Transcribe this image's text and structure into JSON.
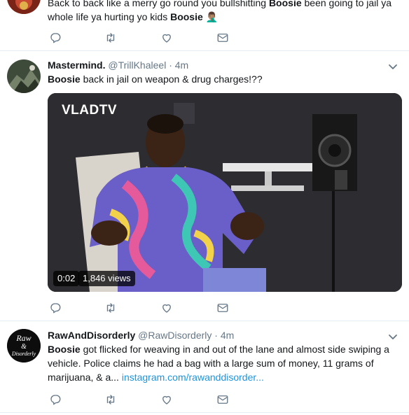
{
  "tweet1": {
    "text_a": "Back to back like a merry go round you bullshitting ",
    "boosie": "Boosie",
    "text_b": " been going to jail ya",
    "text_c": "whole life ya hurting yo kids ",
    "emoji": "🤦🏽‍♂️"
  },
  "tweet2": {
    "name": "Mastermind.",
    "handle": "@TrillKhaleel",
    "time": "· 4m",
    "boosie": "Boosie",
    "text": " back in jail on weapon & drug charges!??",
    "video": {
      "watermark": "VLADTV",
      "duration": "0:02",
      "views": "1,846 views"
    }
  },
  "tweet3": {
    "name": "RawAndDisorderly",
    "handle": "@RawDisorderly",
    "time": "· 4m",
    "boosie": "Boosie",
    "line1": " got flicked for weaving in and out of the lane and almost side swiping a",
    "line2": "vehicle. Police claims he had a bag with a large sum of money, 11 grams of",
    "line3": "marijuana, & a... ",
    "link": "instagram.com/rawanddisorder...",
    "avatar_text": "Raw & Disorderly"
  },
  "icons": [
    "reply-icon",
    "retweet-icon",
    "like-icon",
    "dm-icon",
    "caret-down-icon"
  ],
  "colors": {
    "icon": "#657786",
    "link": "#1b95e0",
    "separator": "#e6ecf0"
  }
}
